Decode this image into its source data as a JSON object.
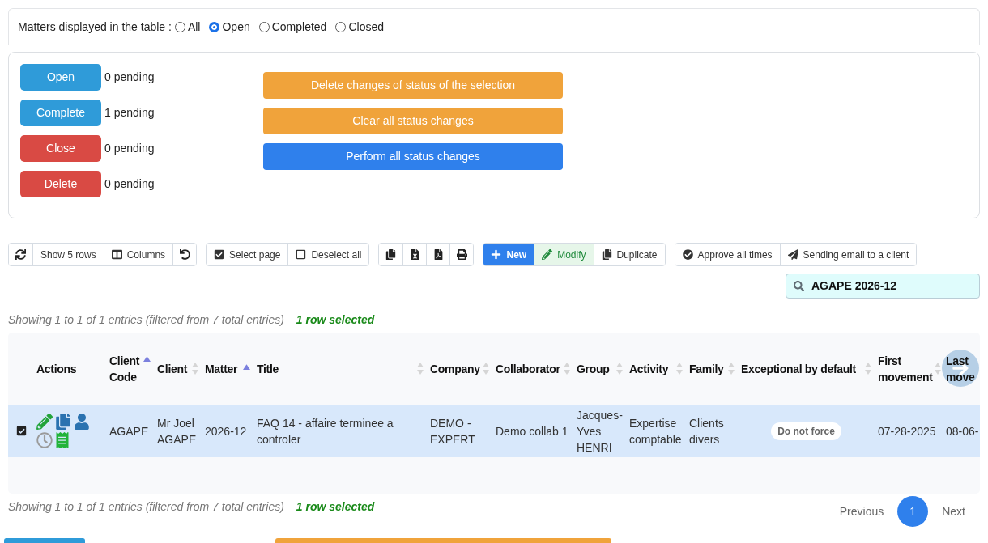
{
  "filter": {
    "label": "Matters displayed in the table :",
    "options": [
      {
        "label": "All",
        "selected": false
      },
      {
        "label": "Open",
        "selected": true
      },
      {
        "label": "Completed",
        "selected": false
      },
      {
        "label": "Closed",
        "selected": false
      }
    ]
  },
  "status_actions": [
    {
      "label": "Open",
      "pending": "0 pending",
      "color": "#2f9bd9"
    },
    {
      "label": "Complete",
      "pending": "1 pending",
      "color": "#2f9bd9"
    },
    {
      "label": "Close",
      "pending": "0 pending",
      "color": "#d94a44"
    },
    {
      "label": "Delete",
      "pending": "0 pending",
      "color": "#d94a44"
    }
  ],
  "bulk_actions": [
    {
      "label": "Delete changes of status of the selection",
      "color": "#f0a33b"
    },
    {
      "label": "Clear all status changes",
      "color": "#f0a33b"
    },
    {
      "label": "Perform all status changes",
      "color": "#2f80ec"
    }
  ],
  "toolbar": [
    {
      "items": [
        {
          "kind": "refresh"
        },
        {
          "kind": "rows",
          "label": "Show 5 rows"
        },
        {
          "kind": "columns",
          "label": "Columns"
        },
        {
          "kind": "reset"
        }
      ]
    },
    {
      "items": [
        {
          "kind": "select",
          "label": "Select page"
        },
        {
          "kind": "deselect",
          "label": "Deselect all"
        }
      ]
    },
    {
      "items": [
        {
          "kind": "copy"
        },
        {
          "kind": "excel"
        },
        {
          "kind": "pdf"
        },
        {
          "kind": "print"
        }
      ]
    },
    {
      "items": [
        {
          "kind": "new",
          "label": "New"
        },
        {
          "kind": "modify",
          "label": "Modify"
        },
        {
          "kind": "duplicate",
          "label": "Duplicate"
        }
      ]
    },
    {
      "items": [
        {
          "kind": "approve",
          "label": "Approve all times"
        },
        {
          "kind": "email",
          "label": "Sending email to a client"
        }
      ]
    }
  ],
  "search": {
    "value": "AGAPE 2026-12"
  },
  "info_top": {
    "entries": "Showing 1 to 1 of 1 entries (filtered from 7 total entries)",
    "selection": "1 row selected"
  },
  "table": {
    "columns": [
      {
        "label": "Actions",
        "kind": "actions"
      },
      {
        "label": "Client Code",
        "sorted": true,
        "kind": "text"
      },
      {
        "label": "Client",
        "sorted": false,
        "kind": "text"
      },
      {
        "label": "Matter",
        "sorted": true,
        "kind": "text"
      },
      {
        "label": "Title",
        "sorted": false,
        "kind": "text"
      },
      {
        "label": "Company",
        "sorted": false,
        "kind": "text"
      },
      {
        "label": "Collaborator",
        "sorted": false,
        "kind": "text"
      },
      {
        "label": "Group",
        "sorted": false,
        "kind": "text"
      },
      {
        "label": "Activity",
        "sorted": false,
        "kind": "text"
      },
      {
        "label": "Family",
        "sorted": false,
        "kind": "text"
      },
      {
        "label": "Exceptional by default",
        "sorted": false,
        "kind": "badge"
      },
      {
        "label": "First movement",
        "sorted": false,
        "kind": "text"
      },
      {
        "label": "Last move",
        "kind": "text"
      }
    ],
    "rows": [
      {
        "selected": true,
        "cells": [
          "",
          "AGAPE",
          "Mr Joel AGAPE",
          "2026-12",
          "FAQ 14 - affaire terminee a controler",
          "DEMO - EXPERT",
          "Demo collab 1",
          "Jacques-Yves HENRI",
          "Expertise comptable",
          "Clients divers",
          "Do not force",
          "07-28-2025",
          "08-06-"
        ]
      }
    ]
  },
  "info_bottom": {
    "entries": "Showing 1 to 1 of 1 entries (filtered from 7 total entries)",
    "selection": "1 row selected"
  },
  "pagination": {
    "previous": "Previous",
    "pages": [
      {
        "label": "1",
        "selected": true
      }
    ],
    "next": "Next"
  }
}
